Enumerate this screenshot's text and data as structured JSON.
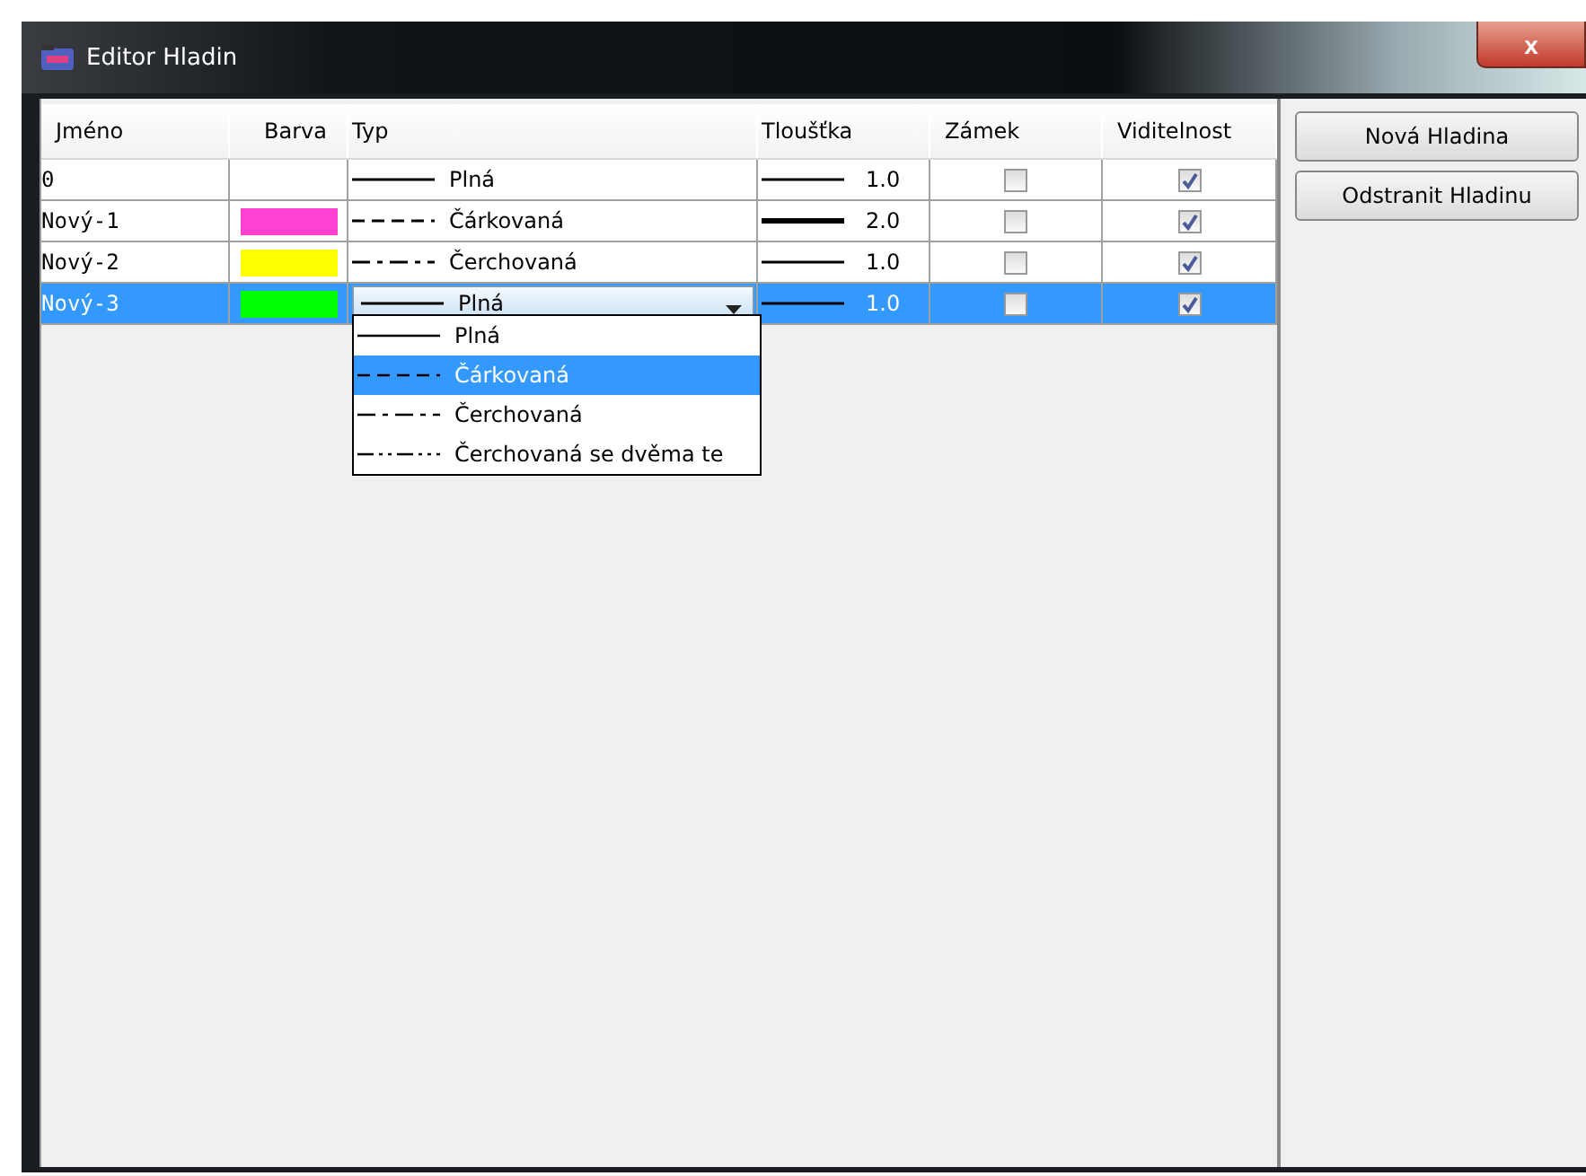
{
  "window": {
    "title": "Editor Hladin",
    "close_label": "x"
  },
  "table": {
    "columns": [
      "Jméno",
      "Barva",
      "Typ",
      "Tloušťka",
      "Zámek",
      "Viditelnost"
    ],
    "rows": [
      {
        "name": "0",
        "type": {
          "kind": "solid",
          "label": "Plná"
        },
        "weight": {
          "bold": false,
          "label": "1.0"
        },
        "locked": false,
        "visible": true,
        "selected": false,
        "editing": false
      },
      {
        "name": "Nový-1",
        "color": "#ff40d0",
        "type": {
          "kind": "dashed",
          "label": "Čárkovaná"
        },
        "weight": {
          "bold": true,
          "label": "2.0"
        },
        "locked": false,
        "visible": true,
        "selected": false,
        "editing": false
      },
      {
        "name": "Nový-2",
        "color": "#ffff00",
        "type": {
          "kind": "dashdot",
          "label": "Čerchovaná"
        },
        "weight": {
          "bold": false,
          "label": "1.0"
        },
        "locked": false,
        "visible": true,
        "selected": false,
        "editing": false
      },
      {
        "name": "Nový-3",
        "color": "#00ff00",
        "type": {
          "kind": "solid",
          "label": "Plná"
        },
        "weight": {
          "bold": false,
          "label": "1.0"
        },
        "locked": false,
        "visible": true,
        "selected": true,
        "editing": true
      }
    ]
  },
  "dropdown": {
    "items": [
      {
        "kind": "solid",
        "label": "Plná",
        "selected": false
      },
      {
        "kind": "dashed",
        "label": "Čárkovaná",
        "selected": true
      },
      {
        "kind": "dashdot",
        "label": "Čerchovaná",
        "selected": false
      },
      {
        "kind": "dashdotdot",
        "label": "Čerchovaná se dvěma te",
        "selected": false
      }
    ]
  },
  "buttons": [
    "Nová Hladina",
    "Odstranit Hladinu"
  ]
}
